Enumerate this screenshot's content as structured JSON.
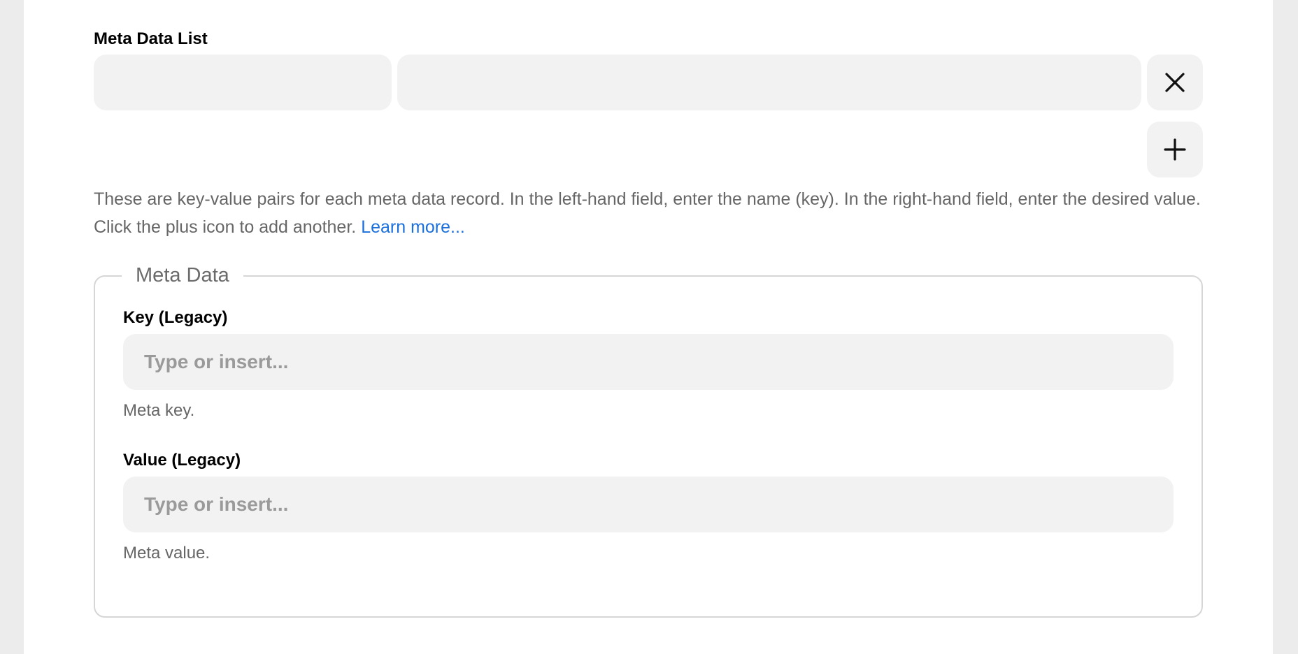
{
  "meta_list": {
    "label": "Meta Data List",
    "rows": [
      {
        "key": "",
        "value": ""
      }
    ],
    "remove_icon": "close-icon",
    "add_icon": "plus-icon",
    "help_text": "These are key-value pairs for each meta data record. In the left-hand field, enter the name (key). In the right-hand field, enter the desired value. Click the plus icon to add another. ",
    "learn_more": "Learn more..."
  },
  "meta_data": {
    "legend": "Meta Data",
    "key_field": {
      "label": "Key (Legacy)",
      "value": "",
      "placeholder": "Type or insert...",
      "help": "Meta key."
    },
    "value_field": {
      "label": "Value (Legacy)",
      "value": "",
      "placeholder": "Type or insert...",
      "help": "Meta value."
    }
  },
  "colors": {
    "background": "#ececec",
    "panel": "#ffffff",
    "input_bg": "#f2f2f2",
    "link": "#1a6fdc",
    "help_text": "#666666",
    "border": "#d6d6d6"
  }
}
